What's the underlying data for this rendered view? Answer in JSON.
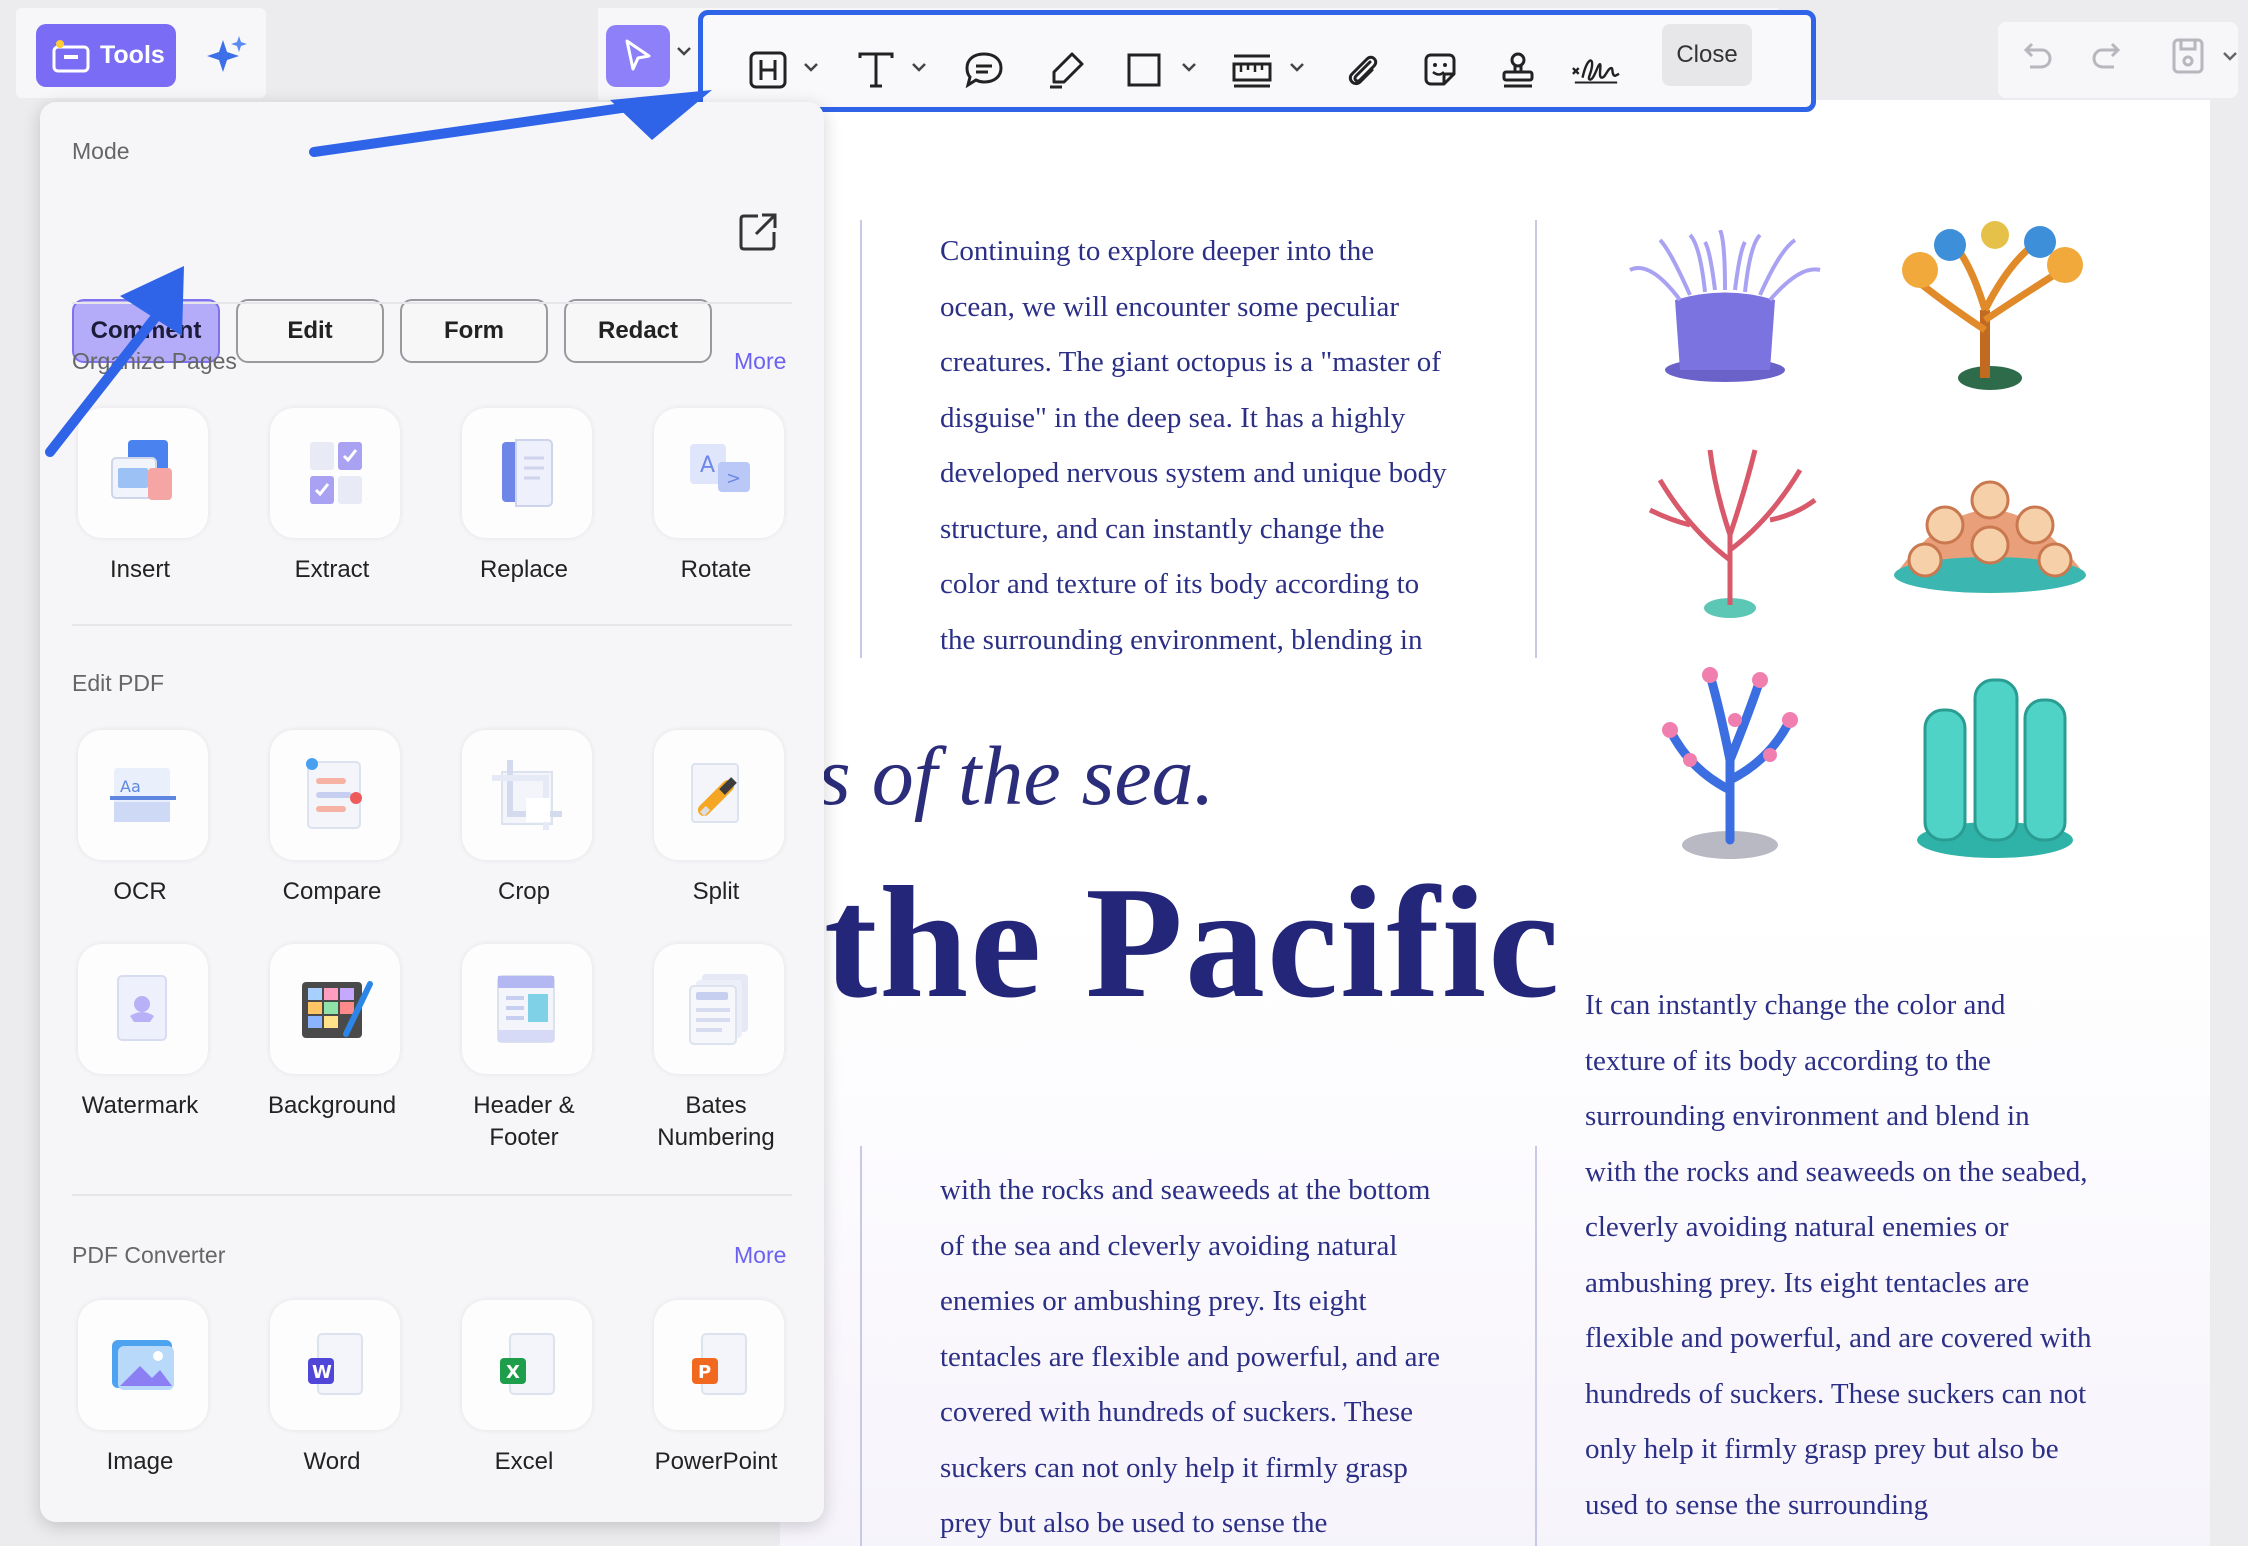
{
  "toolbar": {
    "tools_label": "Tools",
    "close_label": "Close",
    "annotation_tools": [
      "heading-icon",
      "text-icon",
      "comment-icon",
      "highlighter-icon",
      "rectangle-icon",
      "measure-icon",
      "attachment-icon",
      "sticker-icon",
      "stamp-icon",
      "signature-icon"
    ]
  },
  "panel": {
    "mode_title": "Mode",
    "modes": [
      {
        "label": "Comment",
        "active": true
      },
      {
        "label": "Edit",
        "active": false
      },
      {
        "label": "Form",
        "active": false
      },
      {
        "label": "Redact",
        "active": false
      }
    ],
    "organize": {
      "title": "Organize Pages",
      "more": "More",
      "items": [
        {
          "label": "Insert",
          "icon": "insert-icon"
        },
        {
          "label": "Extract",
          "icon": "extract-icon"
        },
        {
          "label": "Replace",
          "icon": "replace-icon"
        },
        {
          "label": "Rotate",
          "icon": "rotate-icon"
        }
      ]
    },
    "edit_pdf": {
      "title": "Edit PDF",
      "items": [
        {
          "label": "OCR",
          "icon": "ocr-icon"
        },
        {
          "label": "Compare",
          "icon": "compare-icon"
        },
        {
          "label": "Crop",
          "icon": "crop-icon"
        },
        {
          "label": "Split",
          "icon": "split-icon"
        },
        {
          "label": "Watermark",
          "icon": "watermark-icon"
        },
        {
          "label": "Background",
          "icon": "background-icon"
        },
        {
          "label": "Header &",
          "label2": "Footer",
          "icon": "header-footer-icon"
        },
        {
          "label": "Bates",
          "label2": "Numbering",
          "icon": "bates-numbering-icon"
        }
      ]
    },
    "converter": {
      "title": "PDF Converter",
      "more": "More",
      "items": [
        {
          "label": "Image",
          "icon": "image-icon"
        },
        {
          "label": "Word",
          "icon": "word-icon"
        },
        {
          "label": "Excel",
          "icon": "excel-icon"
        },
        {
          "label": "PowerPoint",
          "icon": "powerpoint-icon"
        }
      ]
    }
  },
  "document": {
    "col1_top": [
      "Continuing to explore deeper into the",
      "ocean, we will encounter some peculiar",
      "creatures. The giant octopus is a \"master of",
      "disguise\" in the deep sea. It has a highly",
      "developed nervous system and unique body",
      "structure, and can instantly change the",
      "color and texture of its body according to",
      "the surrounding environment, blending in"
    ],
    "heading_italic": "s of the sea.",
    "heading_big": "the Pacific",
    "col2_mid": [
      "It can instantly change the color and",
      "texture of its body according to the",
      "surrounding environment and blend in",
      "with the rocks and seaweeds on the seabed,",
      "cleverly avoiding natural enemies or",
      "ambushing prey. Its eight tentacles are",
      "flexible and powerful, and are covered with",
      "hundreds of suckers. These suckers can not",
      "only help it firmly grasp prey but also be",
      "used to sense the surrounding"
    ],
    "col1_bottom": [
      "with the rocks and seaweeds at the bottom",
      "of the sea and cleverly avoiding natural",
      "enemies or ambushing prey. Its eight",
      "tentacles are flexible and powerful, and are",
      "covered with hundreds of suckers. These",
      "suckers can not only help it firmly grasp",
      "prey but also be used to sense the"
    ]
  },
  "colors": {
    "accent": "#7a6cf5",
    "annotation_highlight": "#2f63e8",
    "doc_text": "#2b2f86"
  }
}
